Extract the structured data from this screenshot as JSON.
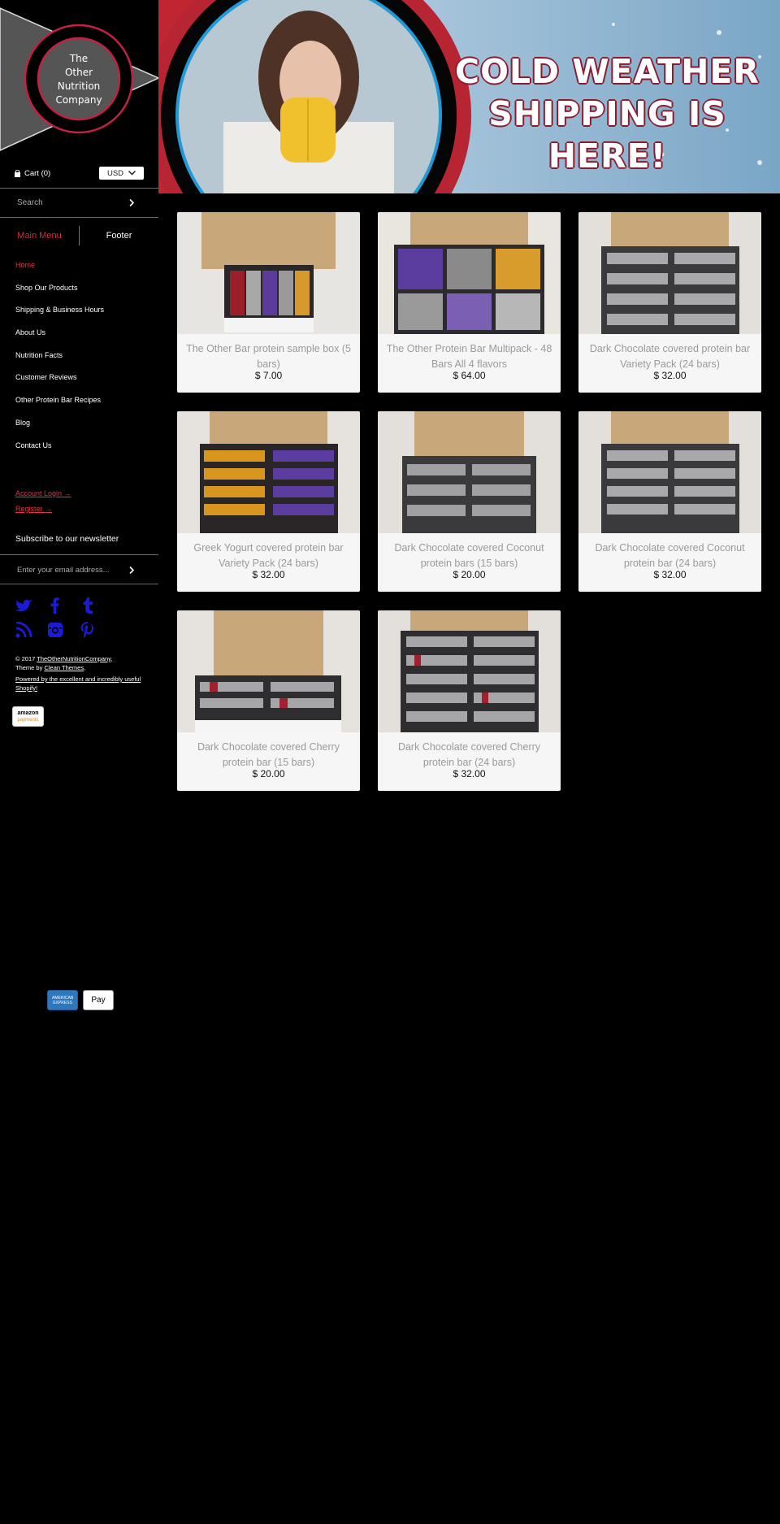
{
  "brand": {
    "logo_lines": [
      "The",
      "Other",
      "Nutrition",
      "Company"
    ]
  },
  "banner": {
    "line1": "COLD WEATHER",
    "line2": "SHIPPING IS HERE!"
  },
  "cart": {
    "label": "Cart (0)"
  },
  "currency": {
    "selected": "USD"
  },
  "search": {
    "placeholder": "Search"
  },
  "menu_tabs": {
    "main": "Main Menu",
    "footer": "Footer"
  },
  "nav": [
    {
      "label": "Home"
    },
    {
      "label": "Shop Our Products"
    },
    {
      "label": "Shipping & Business Hours"
    },
    {
      "label": "About Us"
    },
    {
      "label": "Nutrition Facts"
    },
    {
      "label": "Customer Reviews"
    },
    {
      "label": "Other Protein Bar Recipes"
    },
    {
      "label": "Blog"
    },
    {
      "label": "Contact Us"
    }
  ],
  "account": {
    "login": "Account Login →",
    "register": "Register →"
  },
  "newsletter": {
    "title": "Subscribe to our newsletter",
    "placeholder": "Enter your email address..."
  },
  "footer": {
    "copyright_prefix": "© 2017 ",
    "company_link": "TheOtherNutritionCompany",
    "theme_prefix": "Theme by ",
    "theme_link": "Clean Themes",
    "powered": "Powered by the excellent and incredibly useful Shopify!",
    "amazon_line1": "amazon",
    "amazon_line2": "payments",
    "amex": "AMERICAN EXPRESS",
    "apple_pay": " Pay"
  },
  "products": [
    {
      "name": "The Other Bar protein sample box (5 bars)",
      "price": "$ 7.00"
    },
    {
      "name": "The Other Protein Bar Multipack - 48 Bars All 4 flavors",
      "price": "$ 64.00"
    },
    {
      "name": "Dark Chocolate covered protein bar Variety Pack (24 bars)",
      "price": "$ 32.00"
    },
    {
      "name": "Greek Yogurt covered protein bar Variety Pack (24 bars)",
      "price": "$ 32.00"
    },
    {
      "name": "Dark Chocolate covered Coconut protein bars (15 bars)",
      "price": "$ 20.00"
    },
    {
      "name": "Dark Chocolate covered Coconut protein bar (24 bars)",
      "price": "$ 32.00"
    },
    {
      "name": "Dark Chocolate covered Cherry protein bar (15 bars)",
      "price": "$ 20.00"
    },
    {
      "name": "Dark Chocolate covered Cherry protein bar (24 bars)",
      "price": "$ 32.00"
    }
  ],
  "colors": {
    "accent": "#e0324c",
    "background": "#000000",
    "card": "#f6f6f6"
  }
}
